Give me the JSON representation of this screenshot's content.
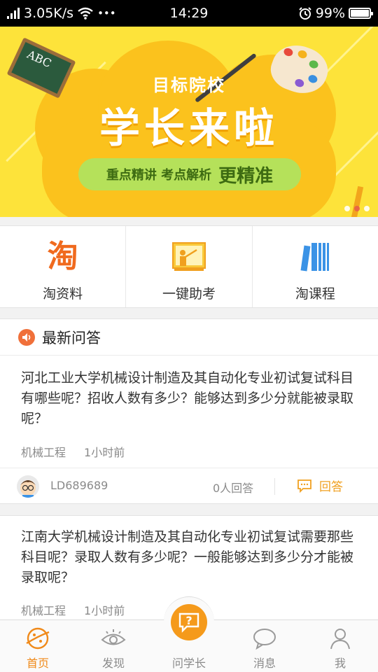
{
  "status_bar": {
    "speed": "3.05K/s",
    "more": "•••",
    "time": "14:29",
    "battery": "99%"
  },
  "banner": {
    "board_text": "ABC",
    "subtitle": "目标院校",
    "title": "学长来啦",
    "tag_small": "重点精讲 考点解析",
    "tag_big": "更精准",
    "colors": {
      "bg": "#fde33a",
      "cloud": "#fbc21d",
      "tag": "#b5e15a"
    }
  },
  "quick": [
    {
      "label": "淘资料",
      "icon": "taobao-char-icon"
    },
    {
      "label": "一键助考",
      "icon": "teacher-board-icon"
    },
    {
      "label": "淘课程",
      "icon": "books-icon"
    }
  ],
  "latest": {
    "title": "最新问答",
    "items": [
      {
        "question": "河北工业大学机械设计制造及其自动化专业初试复试科目有哪些呢？招收人数有多少？能够达到多少分就能被录取呢？",
        "category": "机械工程",
        "time": "1小时前",
        "user": "LD689689",
        "answers": "0人回答",
        "answer_label": "回答"
      },
      {
        "question": "江南大学机械设计制造及其自动化专业初试复试需要那些科目呢？录取人数有多少呢？一般能够达到多少分才能被录取呢？",
        "category": "机械工程",
        "time": "1小时前"
      }
    ]
  },
  "tabbar": {
    "tabs": [
      {
        "label": "首页",
        "icon": "home-planet-icon",
        "active": true
      },
      {
        "label": "发现",
        "icon": "eye-icon",
        "active": false
      },
      {
        "label": "问学长",
        "icon": "question-bubble-icon",
        "active": false
      },
      {
        "label": "消息",
        "icon": "chat-bubble-icon",
        "active": false
      },
      {
        "label": "我",
        "icon": "person-icon",
        "active": false
      }
    ],
    "active_color": "#f08a1a"
  }
}
